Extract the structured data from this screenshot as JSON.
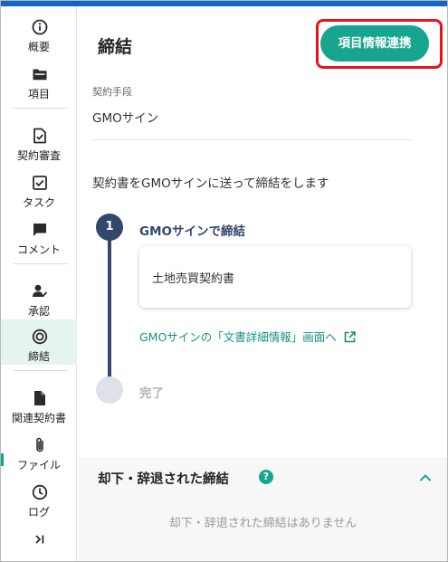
{
  "colors": {
    "accent": "#17a58f",
    "link": "#15907d",
    "step_active": "#34486b",
    "step_inactive": "#dfe1e8",
    "top_bar": "#1565c0",
    "highlight_outline": "#e8131a"
  },
  "sidebar": {
    "items": [
      {
        "label": "概要",
        "icon": "info-icon"
      },
      {
        "label": "項目",
        "icon": "folder-icon"
      },
      {
        "label": "契約審査",
        "icon": "doc-check-icon"
      },
      {
        "label": "タスク",
        "icon": "checkbox-icon"
      },
      {
        "label": "コメント",
        "icon": "comment-icon"
      },
      {
        "label": "承認",
        "icon": "approval-user-icon"
      },
      {
        "label": "締結",
        "icon": "target-icon",
        "active": true
      },
      {
        "label": "関連契約書",
        "icon": "document-icon"
      },
      {
        "label": "ファイル",
        "icon": "paperclip-icon"
      },
      {
        "label": "ログ",
        "icon": "clock-icon"
      },
      {
        "label": "",
        "icon": "collapse-panel-icon"
      }
    ]
  },
  "main": {
    "title": "締結",
    "link_button": "項目情報連携",
    "method_label": "契約手段",
    "method_value": "GMOサイン",
    "description": "契約書をGMOサインに送って締結をします",
    "steps": [
      {
        "number": "1",
        "title": "GMOサインで締結",
        "document": "土地売買契約書",
        "link": "GMOサインの「文書詳細情報」画面へ"
      },
      {
        "number": "",
        "title": "完了"
      }
    ]
  },
  "rejected": {
    "title": "却下・辞退された締結",
    "help": "?",
    "empty": "却下・辞退された締結はありません"
  }
}
